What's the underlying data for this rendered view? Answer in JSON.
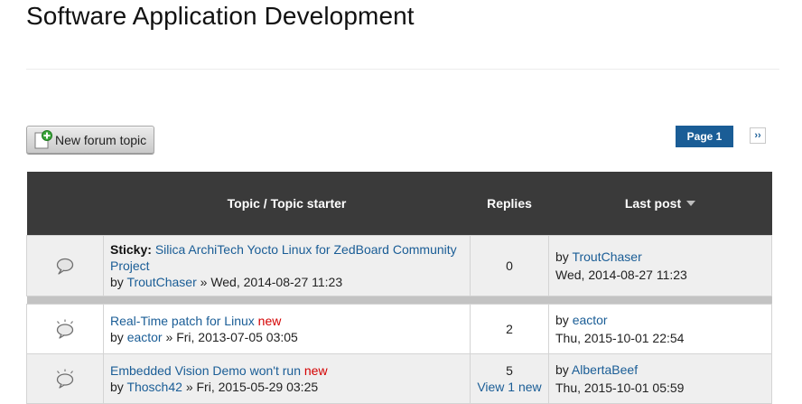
{
  "page": {
    "title": "Software Application Development"
  },
  "toolbar": {
    "new_topic_label": "New forum topic",
    "new_topic_icon": "new-document-icon"
  },
  "pager": {
    "current_label": "Page 1",
    "next_label": "››"
  },
  "table": {
    "headers": {
      "topic": "Topic / Topic starter",
      "replies": "Replies",
      "last_post": "Last post"
    },
    "rows": [
      {
        "sticky_label": "Sticky:",
        "title": "Silica ArchiTech Yocto Linux for ZedBoard Community Project",
        "by_label": "by",
        "author": "TroutChaser",
        "date_sep": "»",
        "date": "Wed, 2014-08-27 11:23",
        "new_flag": "",
        "replies": "0",
        "replies_new": "",
        "last_by_label": "by",
        "last_user": "TroutChaser",
        "last_date": "Wed, 2014-08-27 11:23",
        "icon": "topic-read-icon"
      },
      {
        "sticky_label": "",
        "title": "Real-Time patch for Linux",
        "by_label": "by",
        "author": "eactor",
        "date_sep": "»",
        "date": "Fri, 2013-07-05 03:05",
        "new_flag": "new",
        "replies": "2",
        "replies_new": "",
        "last_by_label": "by",
        "last_user": "eactor",
        "last_date": "Thu, 2015-10-01 22:54",
        "icon": "topic-new-icon"
      },
      {
        "sticky_label": "",
        "title": "Embedded Vision Demo won't run",
        "by_label": "by",
        "author": "Thosch42",
        "date_sep": "»",
        "date": "Fri, 2015-05-29 03:25",
        "new_flag": "new",
        "replies": "5",
        "replies_new": "View 1 new",
        "last_by_label": "by",
        "last_user": "AlbertaBeef",
        "last_date": "Thu, 2015-10-01 05:59",
        "icon": "topic-new-icon"
      }
    ]
  },
  "colors": {
    "link": "#1a5d96",
    "new_flag": "#d40000",
    "header_bg": "#3a3a3a",
    "pager_current_bg": "#1a5d96",
    "row_alt_bg": "#efefef",
    "sticky_separator": "#c3c3c3"
  }
}
